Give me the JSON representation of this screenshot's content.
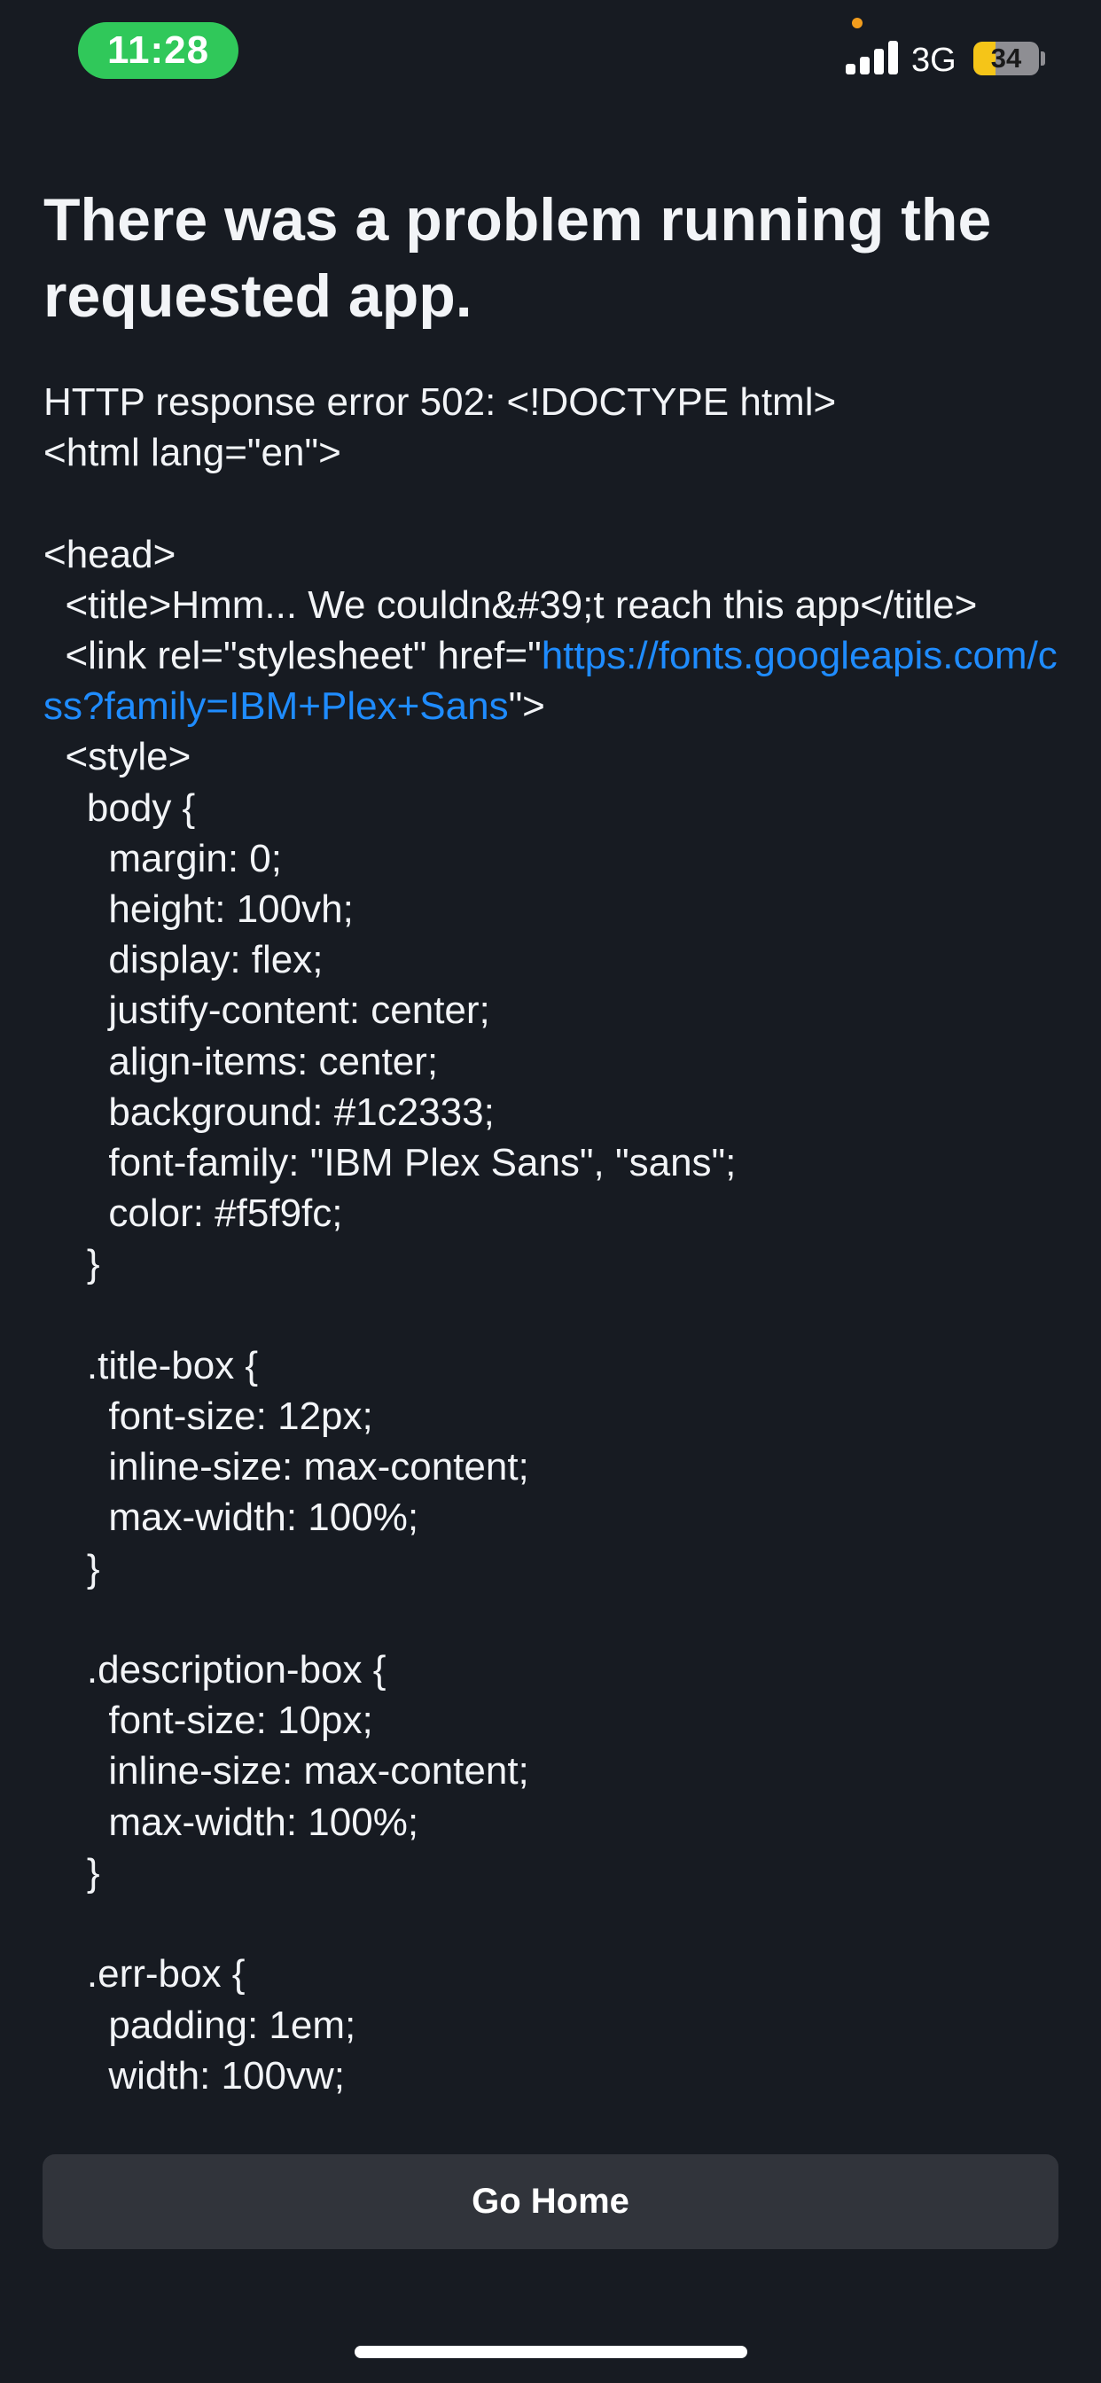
{
  "status_bar": {
    "time": "11:28",
    "network": "3G",
    "battery_level": 34,
    "battery_label": "34",
    "privacy_dot_color": "#f29d1d",
    "time_pill_color": "#30c85a",
    "battery_color": "#f5c518"
  },
  "error": {
    "title": "There was a problem running the requested app.",
    "body_before_link": "HTTP response error 502: <!DOCTYPE html>\n<html lang=\"en\">\n\n<head>\n  <title>Hmm... We couldn&#39;t reach this app</title>\n  <link rel=\"stylesheet\" href=\"",
    "link_url": "https://fonts.googleapis.com/css?family=IBM+Plex+Sans",
    "body_after_link": "\">\n  <style>\n    body {\n      margin: 0;\n      height: 100vh;\n      display: flex;\n      justify-content: center;\n      align-items: center;\n      background: #1c2333;\n      font-family: \"IBM Plex Sans\", \"sans\";\n      color: #f5f9fc;\n    }\n\n    .title-box {\n      font-size: 12px;\n      inline-size: max-content;\n      max-width: 100%;\n    }\n\n    .description-box {\n      font-size: 10px;\n      inline-size: max-content;\n      max-width: 100%;\n    }\n\n    .err-box {\n      padding: 1em;\n      width: 100vw;\n\n\n    }"
  },
  "actions": {
    "go_home_label": "Go Home"
  },
  "colors": {
    "background": "#171b22",
    "text": "#f2f4f7",
    "link": "#1f8cff",
    "button_background": "#31343b"
  }
}
